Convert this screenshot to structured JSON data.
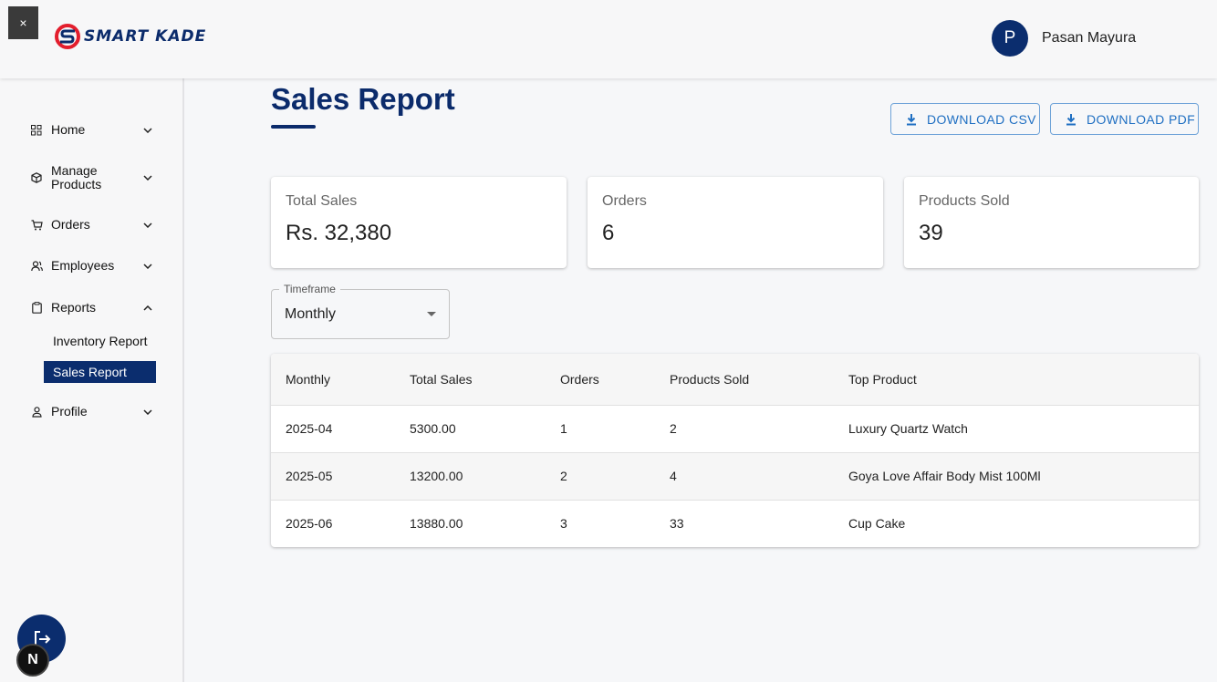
{
  "header": {
    "close_label": "×",
    "logo_text": "SMART KADE",
    "user_initial": "P",
    "user_name": "Pasan Mayura"
  },
  "sidebar": {
    "items": [
      {
        "label": "Home",
        "icon": "grid-icon",
        "expanded": false
      },
      {
        "label": "Manage Products",
        "icon": "box-icon",
        "expanded": false
      },
      {
        "label": "Orders",
        "icon": "cart-icon",
        "expanded": false
      },
      {
        "label": "Employees",
        "icon": "people-icon",
        "expanded": false
      },
      {
        "label": "Reports",
        "icon": "clipboard-icon",
        "expanded": true
      },
      {
        "label": "Profile",
        "icon": "person-icon",
        "expanded": false
      }
    ],
    "reports_sub": [
      {
        "label": "Inventory Report",
        "active": false
      },
      {
        "label": "Sales Report",
        "active": true
      }
    ],
    "badge": "N"
  },
  "main": {
    "title": "Sales Report",
    "download_csv": "DOWNLOAD CSV",
    "download_pdf": "DOWNLOAD PDF",
    "cards": [
      {
        "label": "Total Sales",
        "value": "Rs. 32,380"
      },
      {
        "label": "Orders",
        "value": "6"
      },
      {
        "label": "Products Sold",
        "value": "39"
      }
    ],
    "timeframe": {
      "label": "Timeframe",
      "value": "Monthly"
    },
    "table": {
      "headers": [
        "Monthly",
        "Total Sales",
        "Orders",
        "Products Sold",
        "Top Product"
      ],
      "rows": [
        [
          "2025-04",
          "5300.00",
          "1",
          "2",
          "Luxury Quartz Watch"
        ],
        [
          "2025-05",
          "13200.00",
          "2",
          "4",
          "Goya Love Affair Body Mist 100Ml"
        ],
        [
          "2025-06",
          "13880.00",
          "3",
          "33",
          "Cup Cake"
        ]
      ]
    }
  },
  "colors": {
    "primary": "#0b2d6e",
    "accent_red": "#e31e2d",
    "button_blue": "#1f6fc2"
  }
}
